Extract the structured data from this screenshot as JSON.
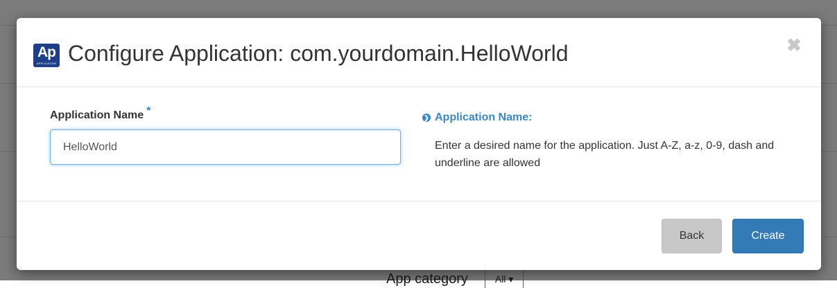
{
  "background": {
    "category_label": "App category",
    "category_filter": "All ▾"
  },
  "dialog": {
    "icon_text": "Ap",
    "icon_subtext": "APPLICATION",
    "title": "Configure Application: com.yourdomain.HelloWorld",
    "close_glyph": "✖",
    "field_label": "Application Name",
    "required_marker": "*",
    "field_value": "HelloWorld",
    "help_arrow": "❯",
    "help_title": "Application Name:",
    "help_text": "Enter a desired name for the application. Just A-Z, a-z, 0-9, dash and underline are allowed",
    "back_label": "Back",
    "create_label": "Create"
  },
  "colors": {
    "accent": "#337ab7",
    "help_link": "#3a87c8",
    "icon_bg": "#1d3f88",
    "backdrop": "#7b7b7b"
  }
}
